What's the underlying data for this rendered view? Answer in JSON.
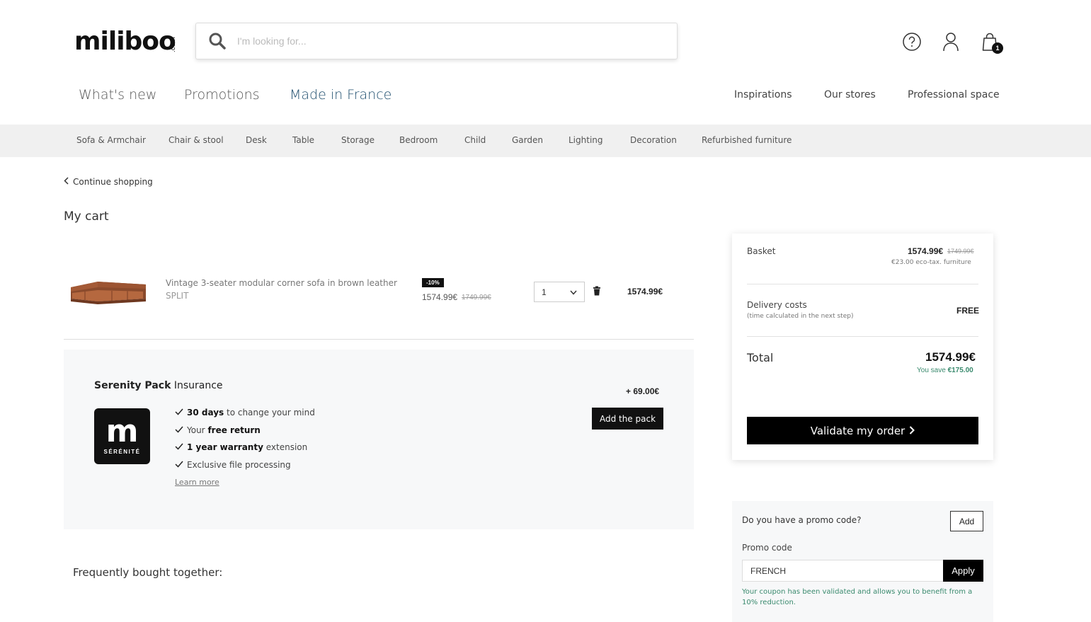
{
  "header": {
    "logo_text": "miliboo",
    "logo_suffix": ".com",
    "search_placeholder": "I'm looking for...",
    "cart_count": "1",
    "icons": [
      "help-icon",
      "user-icon",
      "cart-icon"
    ]
  },
  "main_nav": [
    {
      "label": "What's new"
    },
    {
      "label": "Promotions"
    },
    {
      "label": "Made in France"
    }
  ],
  "right_nav": [
    {
      "label": "Inspirations"
    },
    {
      "label": "Our stores"
    },
    {
      "label": "Professional space"
    }
  ],
  "categories": [
    "Sofa & Armchair",
    "Chair & stool",
    "Desk",
    "Table",
    "Storage",
    "Bedroom",
    "Child",
    "Garden",
    "Lighting",
    "Decoration",
    "Refurbished furniture"
  ],
  "cart": {
    "continue_label": "Continue shopping",
    "title": "My cart",
    "item": {
      "name": "Vintage 3-seater modular corner sofa in brown leather",
      "variant": "SPLIT",
      "discount": "-10%",
      "price": "1574.99€",
      "old_price": "1749.99€",
      "quantity": "1",
      "line_total": "1574.99€"
    },
    "pack": {
      "title_bold": "Serenity Pack",
      "title_rest": " Insurance",
      "logo_letter": "m",
      "logo_caption": "SÉRÉNITÉ",
      "price": "+ 69.00€",
      "button": "Add the pack",
      "features": [
        {
          "bold": "30 days",
          "text": " to change your mind",
          "prefix": ""
        },
        {
          "bold": "free return",
          "text": "",
          "prefix": "Your "
        },
        {
          "bold": "1 year warranty",
          "text": " extension",
          "prefix": ""
        },
        {
          "bold": "",
          "text": "Exclusive file processing",
          "prefix": ""
        }
      ],
      "learn_more": "Learn more"
    },
    "frequently_bought": "Frequently bought together:"
  },
  "summary": {
    "basket_label": "Basket",
    "basket_price": "1574.99€",
    "basket_old_price": "1749.99€",
    "eco_tax": "€23.00 eco-tax. furniture",
    "delivery_label": "Delivery costs",
    "delivery_sub": "(time calculated in the next step)",
    "delivery_value": "FREE",
    "total_label": "Total",
    "total_value": "1574.99€",
    "save_prefix": "You save ",
    "save_value": "€175.00",
    "validate_label": "Validate my order"
  },
  "promo": {
    "question": "Do you have a promo code?",
    "add_label": "Add",
    "code_label": "Promo code",
    "code_value": "FRENCH",
    "apply_label": "Apply",
    "message": "Your coupon has been validated and allows you to benefit from a 10% reduction."
  },
  "colors": {
    "accent": "#1f4e6e",
    "success": "#3a8a6e",
    "button": "#000000",
    "pack_bg": "#f7f8f9"
  }
}
